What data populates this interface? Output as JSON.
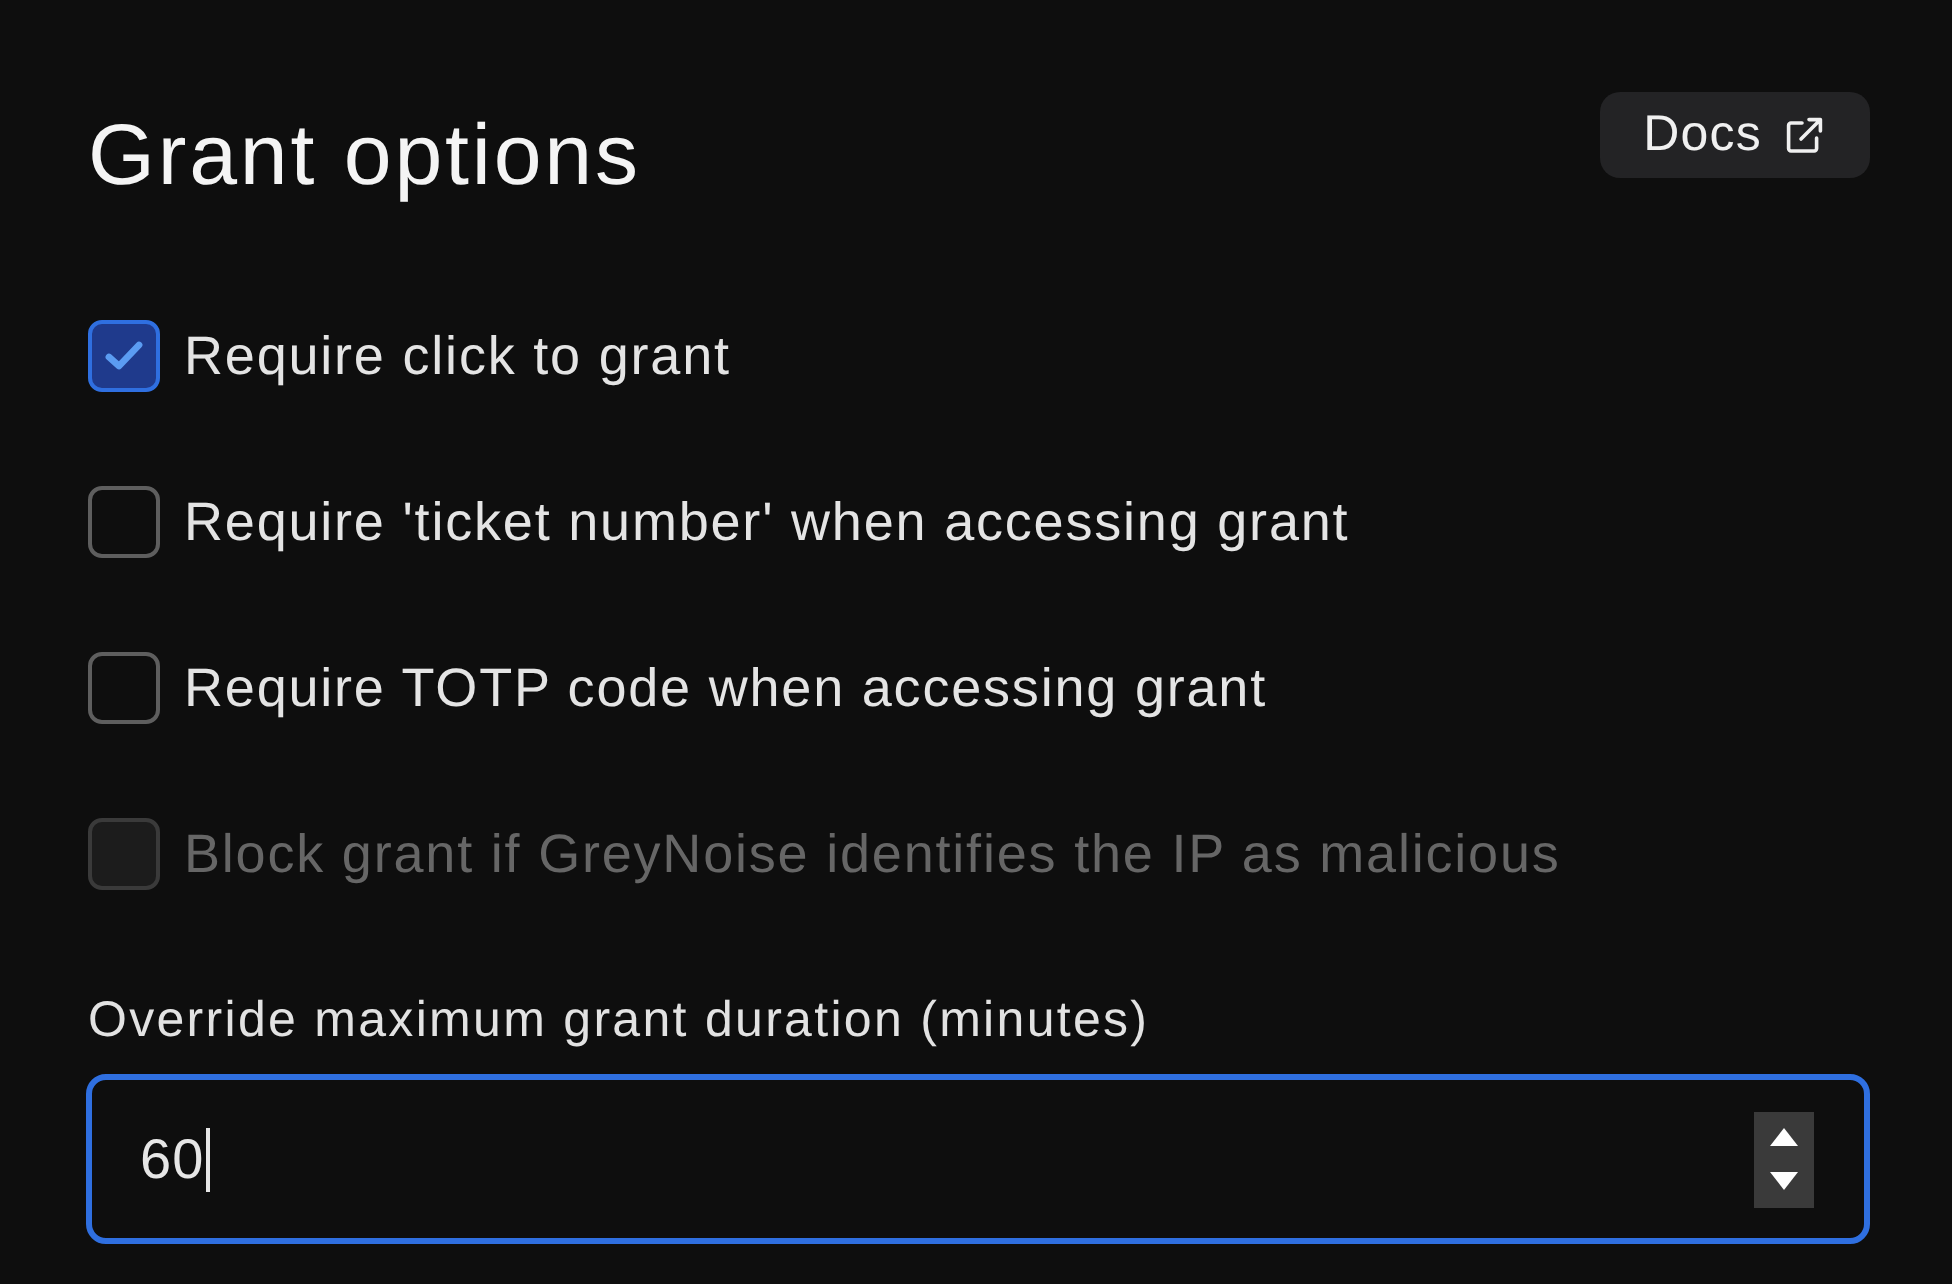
{
  "title": "Grant options",
  "docs_button": {
    "label": "Docs"
  },
  "options": [
    {
      "label": "Require click to grant",
      "checked": true,
      "disabled": false
    },
    {
      "label": "Require 'ticket number' when accessing grant",
      "checked": false,
      "disabled": false
    },
    {
      "label": "Require TOTP code when accessing grant",
      "checked": false,
      "disabled": false
    },
    {
      "label": "Block grant if GreyNoise identifies the IP as malicious",
      "checked": false,
      "disabled": true
    }
  ],
  "duration": {
    "label": "Override maximum grant duration (minutes)",
    "value": "60",
    "focused": true
  }
}
